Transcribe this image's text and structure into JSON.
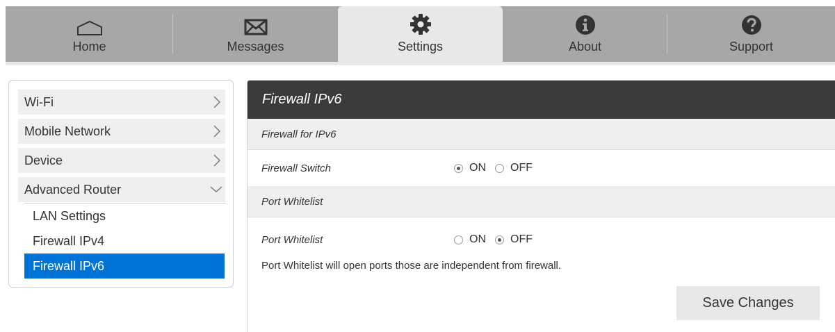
{
  "nav": {
    "tabs": [
      {
        "label": "Home",
        "icon": "home-icon"
      },
      {
        "label": "Messages",
        "icon": "envelope-icon"
      },
      {
        "label": "Settings",
        "icon": "gear-icon",
        "active": true
      },
      {
        "label": "About",
        "icon": "info-icon"
      },
      {
        "label": "Support",
        "icon": "question-icon"
      }
    ]
  },
  "sidebar": {
    "items": [
      {
        "label": "Wi-Fi"
      },
      {
        "label": "Mobile Network"
      },
      {
        "label": "Device"
      },
      {
        "label": "Advanced Router",
        "expanded": true
      }
    ],
    "subitems": [
      {
        "label": "LAN Settings"
      },
      {
        "label": "Firewall IPv4"
      },
      {
        "label": "Firewall IPv6",
        "active": true
      }
    ]
  },
  "panel": {
    "title": "Firewall IPv6",
    "section1": "Firewall for IPv6",
    "firewall_switch": {
      "label": "Firewall Switch",
      "on": "ON",
      "off": "OFF",
      "value": "ON"
    },
    "section2": "Port Whitelist",
    "port_whitelist": {
      "label": "Port Whitelist",
      "on": "ON",
      "off": "OFF",
      "value": "OFF"
    },
    "note": "Port Whitelist will open ports those are independent from firewall.",
    "save_label": "Save Changes"
  },
  "colors": {
    "accent": "#0073d6",
    "nav_bg": "#a7a7a7",
    "title_bg": "#3b3b3b"
  }
}
